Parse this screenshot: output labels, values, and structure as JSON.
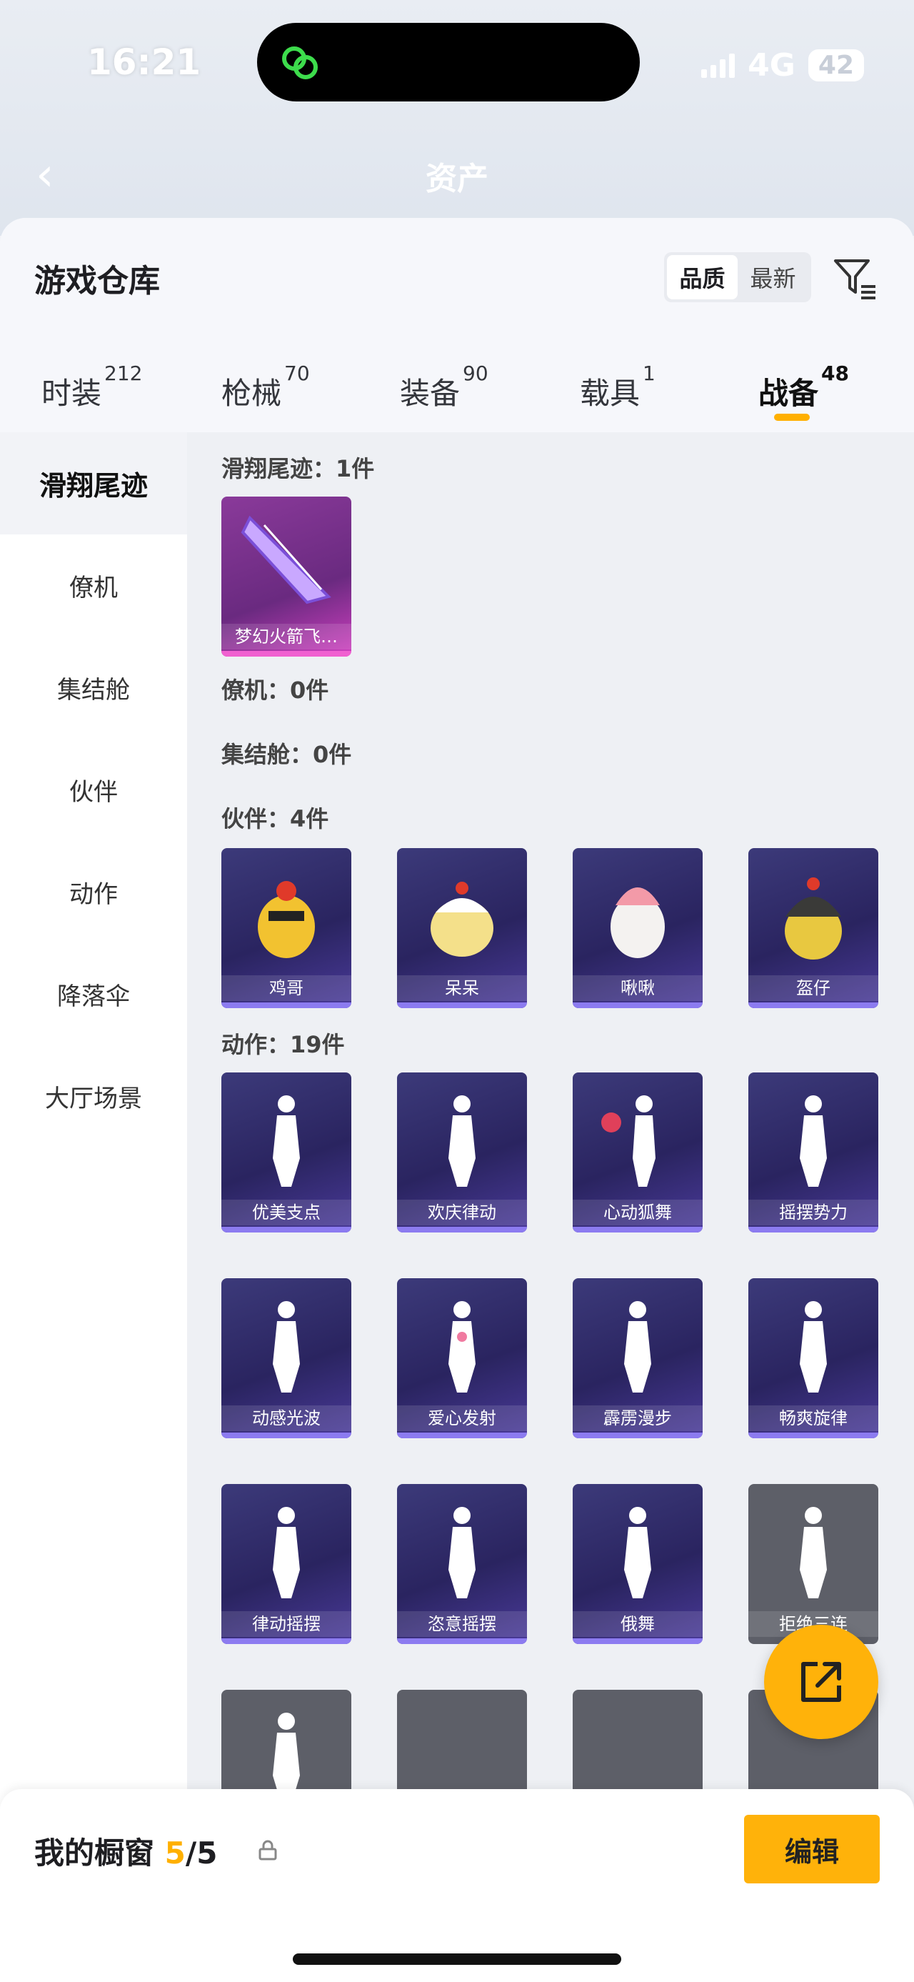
{
  "status_bar": {
    "time": "16:21",
    "network": "4G",
    "battery": "42"
  },
  "nav": {
    "title": "资产"
  },
  "header": {
    "title": "游戏仓库",
    "sort_options": [
      "品质",
      "最新"
    ]
  },
  "tabs": [
    {
      "label": "时装",
      "count": "212"
    },
    {
      "label": "枪械",
      "count": "70"
    },
    {
      "label": "装备",
      "count": "90"
    },
    {
      "label": "载具",
      "count": "1"
    },
    {
      "label": "战备",
      "count": "48"
    }
  ],
  "sidebar": {
    "items": [
      "滑翔尾迹",
      "僚机",
      "集结舱",
      "伙伴",
      "动作",
      "降落伞",
      "大厅场景"
    ]
  },
  "sections": [
    {
      "title": "滑翔尾迹：1件",
      "items": [
        "梦幻火箭飞…"
      ]
    },
    {
      "title": "僚机：0件"
    },
    {
      "title": "集结舱：0件"
    },
    {
      "title": "伙伴：4件",
      "items": [
        "鸡哥",
        "呆呆",
        "啾啾",
        "盔仔"
      ]
    },
    {
      "title": "动作：19件",
      "items": [
        "优美支点",
        "欢庆律动",
        "心动狐舞",
        "摇摆势力",
        "动感光波",
        "爱心发射",
        "霹雳漫步",
        "畅爽旋律",
        "律动摇摆",
        "恣意摇摆",
        "俄舞",
        "拒绝三连"
      ]
    }
  ],
  "bottom": {
    "title": "我的橱窗",
    "count_current": "5",
    "count_total": "/5",
    "edit_label": "编辑"
  },
  "colors": {
    "accent": "#ffb20a",
    "card_purple": "#2a2460",
    "card_pink": "#6a2a80",
    "locked": "#5d5f68"
  }
}
